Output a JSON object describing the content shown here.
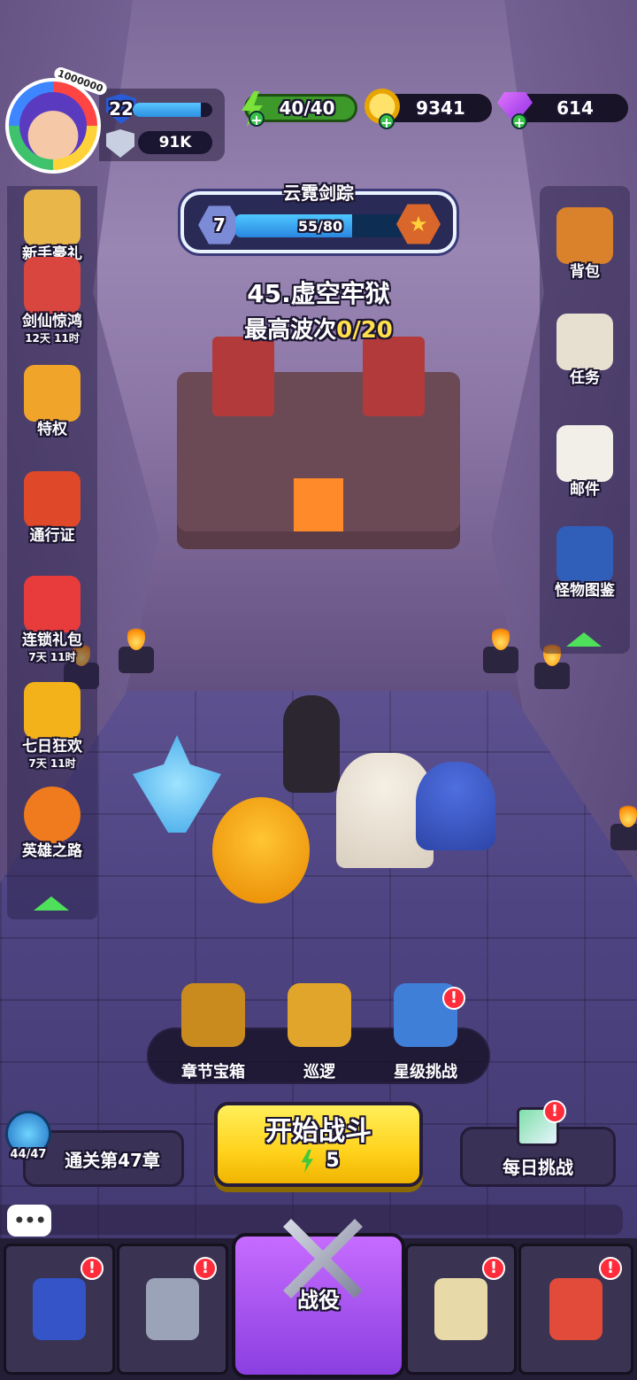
{
  "player": {
    "badge": "1000000",
    "level": "22",
    "xp_fraction": 0.85,
    "power": "91K"
  },
  "resources": {
    "energy": "40/40",
    "gold": "9341",
    "gems": "614"
  },
  "chapter": {
    "title": "云霓剑踪",
    "level": "7",
    "progress_text": "55/80",
    "progress_fraction": 0.6875
  },
  "stage": {
    "name": "45.虚空牢狱",
    "wave_prefix": "最高波次",
    "wave_value": "0/20"
  },
  "left_menu": [
    {
      "label": "新手豪礼",
      "icon": "gift-icon",
      "timer": ""
    },
    {
      "label": "剑仙惊鸿",
      "icon": "heroes-banner-icon",
      "timer": "12天 11时"
    },
    {
      "label": "特权",
      "icon": "privilege-cards-icon",
      "timer": ""
    },
    {
      "label": "通行证",
      "icon": "pass-chest-icon",
      "timer": ""
    },
    {
      "label": "连锁礼包",
      "icon": "chain-gift-icon",
      "timer": "7天 11时"
    },
    {
      "label": "七日狂欢",
      "icon": "seven-day-icon",
      "timer": "7天 11时"
    },
    {
      "label": "英雄之路",
      "icon": "hero-road-icon",
      "timer": ""
    }
  ],
  "right_menu": [
    {
      "label": "背包",
      "icon": "backpack-icon"
    },
    {
      "label": "任务",
      "icon": "task-clipboard-icon"
    },
    {
      "label": "邮件",
      "icon": "mail-icon"
    },
    {
      "label": "怪物图鉴",
      "icon": "monster-book-icon"
    }
  ],
  "actions": [
    {
      "label": "章节宝箱",
      "icon": "chapter-chest-icon",
      "alert": ""
    },
    {
      "label": "巡逻",
      "icon": "patrol-chest-icon",
      "alert": ""
    },
    {
      "label": "星级挑战",
      "icon": "star-challenge-icon",
      "alert": "!"
    }
  ],
  "clear": {
    "count": "44/47",
    "label": "通关第47章"
  },
  "start_battle": {
    "label": "开始战斗",
    "cost": "5"
  },
  "daily": {
    "label": "每日挑战",
    "alert": "!"
  },
  "chat": {
    "icon": "chat-bubble-icon",
    "glyph": "•••"
  },
  "bottom_nav": [
    {
      "label": "",
      "icon": "cards-icon",
      "alert": "!"
    },
    {
      "label": "",
      "icon": "knight-helmet-icon",
      "alert": "!"
    },
    {
      "label": "战役",
      "icon": "crossed-swords-icon",
      "alert": ""
    },
    {
      "label": "",
      "icon": "castle-icon",
      "alert": "!"
    },
    {
      "label": "",
      "icon": "shop-icon",
      "alert": "!"
    }
  ],
  "colors": {
    "energy_green": "#3d9a2a",
    "gold_yellow": "#ffd21c",
    "battle_purple": "#8b3fe0",
    "alert_red": "#ff2d3b"
  }
}
